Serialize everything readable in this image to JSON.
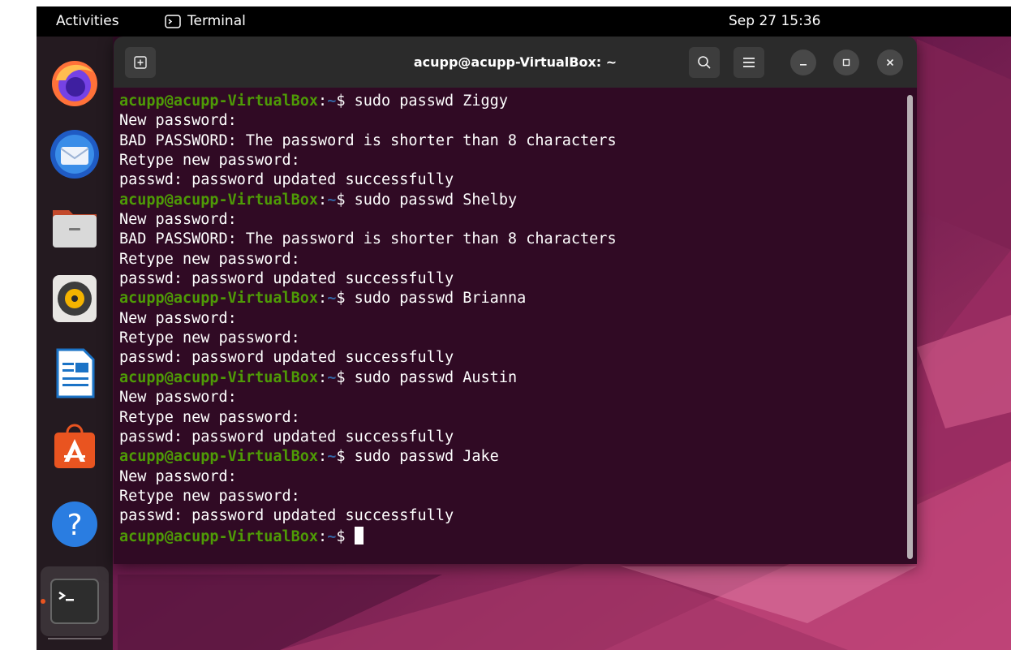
{
  "topbar": {
    "activities": "Activities",
    "app_menu_label": "Terminal",
    "clock": "Sep 27  15:36"
  },
  "dock": {
    "items": [
      {
        "name": "Firefox",
        "icon": "firefox-icon"
      },
      {
        "name": "Thunderbird",
        "icon": "thunderbird-icon"
      },
      {
        "name": "Files",
        "icon": "files-icon"
      },
      {
        "name": "Rhythmbox",
        "icon": "rhythmbox-icon"
      },
      {
        "name": "LibreOffice Writer",
        "icon": "writer-icon"
      },
      {
        "name": "Ubuntu Software",
        "icon": "software-icon"
      },
      {
        "name": "Help",
        "icon": "help-icon"
      },
      {
        "name": "Terminal",
        "icon": "terminal-icon"
      }
    ]
  },
  "window": {
    "title": "acupp@acupp-VirtualBox: ~"
  },
  "terminal": {
    "prompt_user": "acupp@acupp-VirtualBox",
    "prompt_sep": ":",
    "prompt_path": "~",
    "prompt_symbol": "$ ",
    "lines": [
      {
        "type": "prompt",
        "cmd": "sudo passwd Ziggy"
      },
      {
        "type": "out",
        "text": "New password:"
      },
      {
        "type": "out",
        "text": "BAD PASSWORD: The password is shorter than 8 characters"
      },
      {
        "type": "out",
        "text": "Retype new password:"
      },
      {
        "type": "out",
        "text": "passwd: password updated successfully"
      },
      {
        "type": "prompt",
        "cmd": "sudo passwd Shelby"
      },
      {
        "type": "out",
        "text": "New password:"
      },
      {
        "type": "out",
        "text": "BAD PASSWORD: The password is shorter than 8 characters"
      },
      {
        "type": "out",
        "text": "Retype new password:"
      },
      {
        "type": "out",
        "text": "passwd: password updated successfully"
      },
      {
        "type": "prompt",
        "cmd": "sudo passwd Brianna"
      },
      {
        "type": "out",
        "text": "New password:"
      },
      {
        "type": "out",
        "text": "Retype new password:"
      },
      {
        "type": "out",
        "text": "passwd: password updated successfully"
      },
      {
        "type": "prompt",
        "cmd": "sudo passwd Austin"
      },
      {
        "type": "out",
        "text": "New password:"
      },
      {
        "type": "out",
        "text": "Retype new password:"
      },
      {
        "type": "out",
        "text": "passwd: password updated successfully"
      },
      {
        "type": "prompt",
        "cmd": "sudo passwd Jake"
      },
      {
        "type": "out",
        "text": "New password:"
      },
      {
        "type": "out",
        "text": "Retype new password:"
      },
      {
        "type": "out",
        "text": "passwd: password updated successfully"
      },
      {
        "type": "prompt",
        "cmd": "",
        "cursor": true
      }
    ]
  },
  "colors": {
    "terminal_bg": "#300a24",
    "prompt_user": "#4e9a06",
    "prompt_path": "#3465a4",
    "accent": "#e95420"
  }
}
